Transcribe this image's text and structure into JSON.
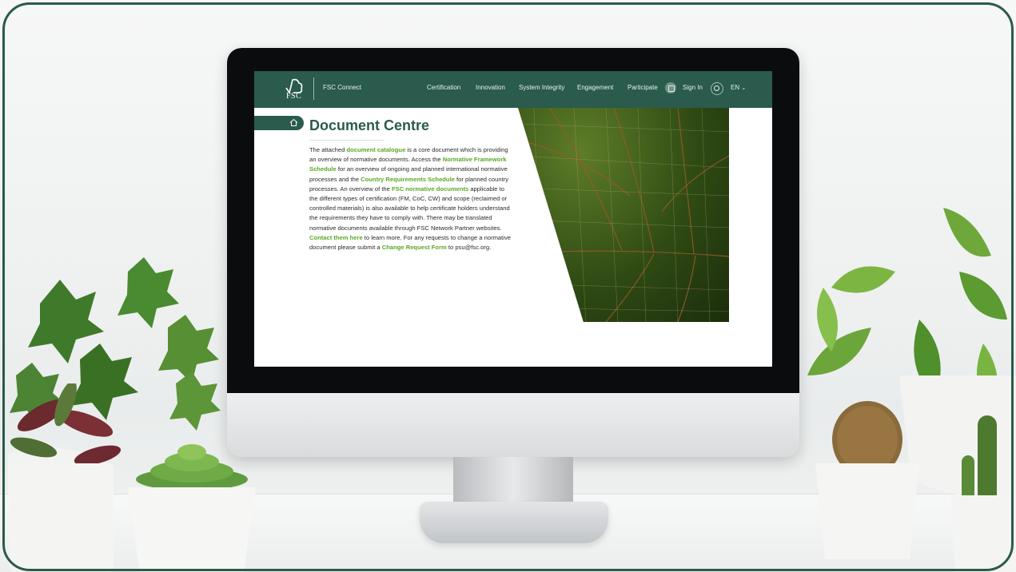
{
  "nav": {
    "logo_text": "FSC",
    "brand": "FSC Connect",
    "items": [
      "Certification",
      "Innovation",
      "System Integrity",
      "Engagement",
      "Participate"
    ],
    "sign_in": "Sign In",
    "language": "EN"
  },
  "page": {
    "title": "Document Centre",
    "paragraph": [
      {
        "text": "The attached ",
        "link": false
      },
      {
        "text": "document catalogue",
        "link": true
      },
      {
        "text": " is a core document which is providing an overview of normative documents. Access the ",
        "link": false
      },
      {
        "text": "Normative Framework Schedule",
        "link": true
      },
      {
        "text": " for an overview of ongoing and planned international normative processes and the ",
        "link": false
      },
      {
        "text": "Country Requirements Schedule",
        "link": true
      },
      {
        "text": " for planned country processes. An overview of the ",
        "link": false
      },
      {
        "text": "FSC normative documents",
        "link": true
      },
      {
        "text": " applicable to the different types of certification (FM, CoC, CW) and scope (reclaimed or controlled materials) is also available to help certificate holders understand the requirements they have to comply with. There may be translated normative documents available through FSC Network Partner websites. ",
        "link": false
      },
      {
        "text": "Contact them here",
        "link": true
      },
      {
        "text": " to learn more. For any requests to change a normative document please submit a ",
        "link": false
      },
      {
        "text": "Change Request Form",
        "link": true
      },
      {
        "text": " to psu@fsc.org.",
        "link": false
      }
    ]
  },
  "colors": {
    "brand_green": "#2a5b4c",
    "link_green": "#5aa823",
    "frame_border": "#2c5a48"
  },
  "icons": [
    "home-icon",
    "grid-icon",
    "search-icon",
    "chevron-down-icon",
    "fsc-tree-logo-icon"
  ]
}
